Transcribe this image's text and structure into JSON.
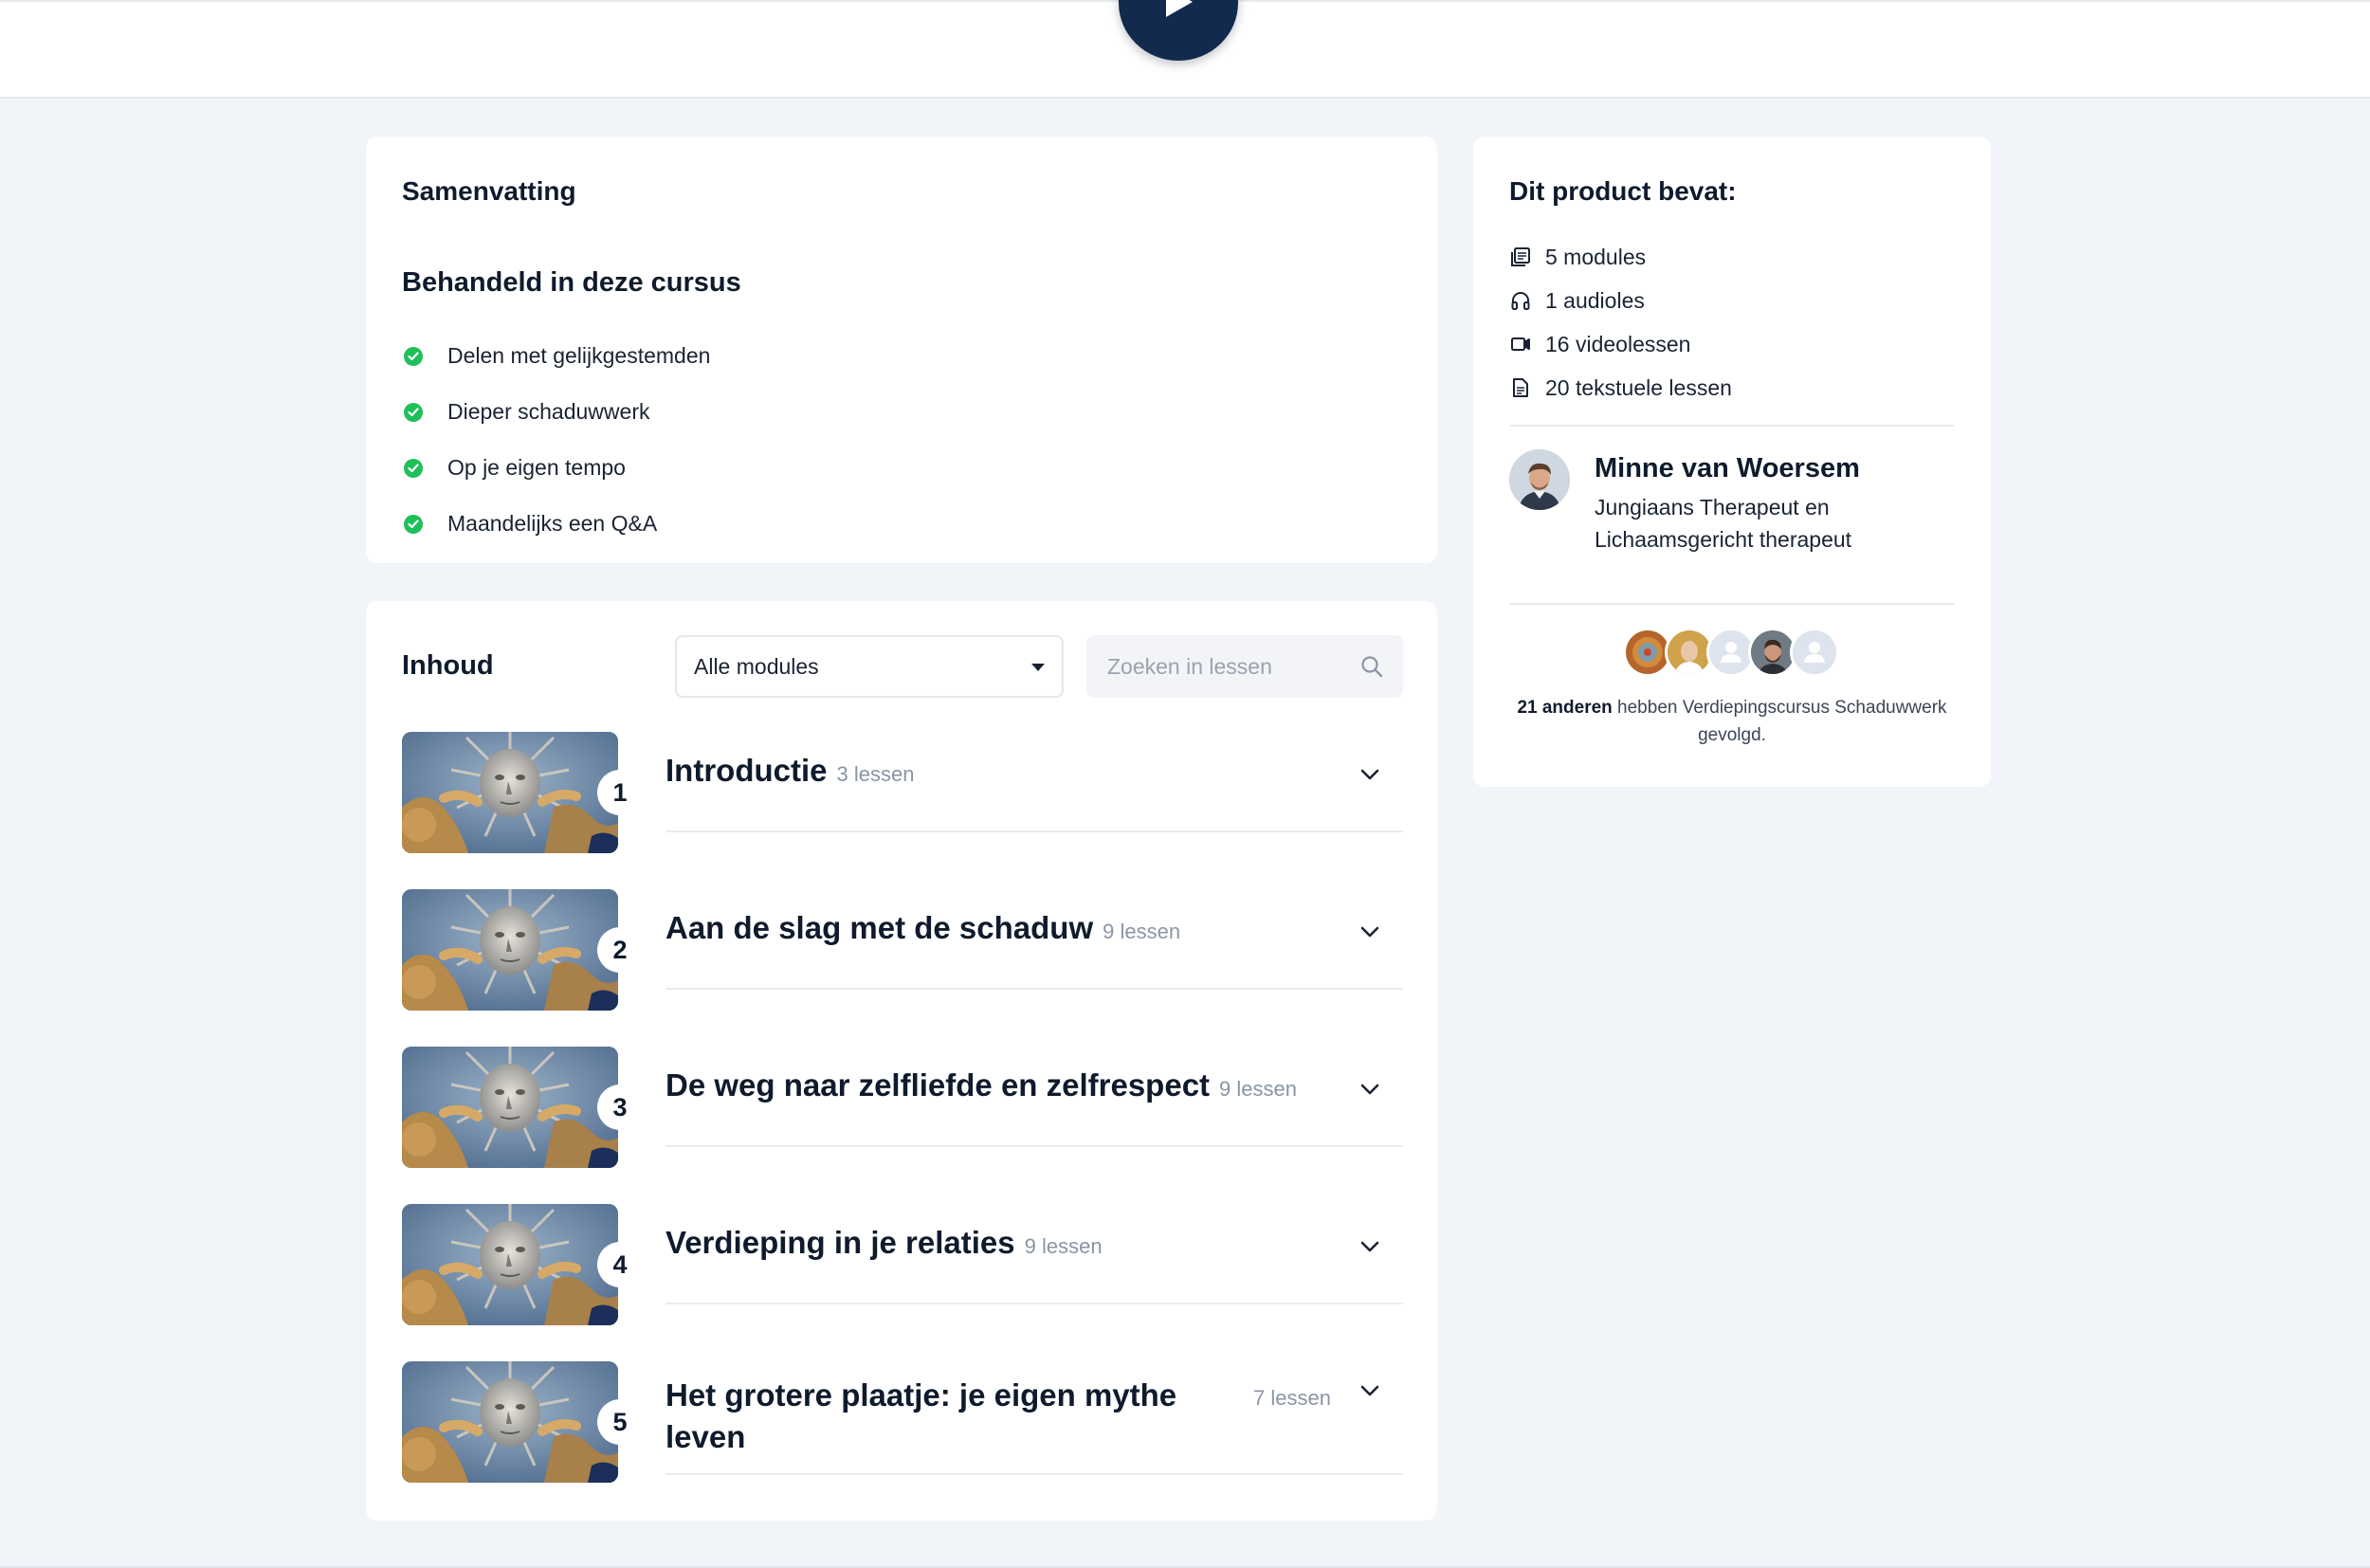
{
  "summary": {
    "title": "Samenvatting",
    "subtitle": "Behandeld in deze cursus",
    "items": [
      "Delen met gelijkgestemden",
      "Dieper schaduwwerk",
      "Op je eigen tempo",
      "Maandelijks een Q&A"
    ]
  },
  "contents": {
    "title": "Inhoud",
    "filter_selected": "Alle modules",
    "search_placeholder": "Zoeken in lessen",
    "modules": [
      {
        "number": "1",
        "title": "Introductie",
        "count": "3 lessen"
      },
      {
        "number": "2",
        "title": "Aan de slag met de schaduw",
        "count": "9 lessen"
      },
      {
        "number": "3",
        "title": "De weg naar zelfliefde en zelfrespect",
        "count": "9 lessen"
      },
      {
        "number": "4",
        "title": "Verdieping in je relaties",
        "count": "9 lessen"
      },
      {
        "number": "5",
        "title": "Het grotere plaatje: je eigen mythe leven",
        "count": "7 lessen"
      }
    ]
  },
  "product": {
    "title": "Dit product bevat:",
    "features": [
      {
        "icon": "modules-icon",
        "label": "5 modules"
      },
      {
        "icon": "headphones-icon",
        "label": "1 audioles"
      },
      {
        "icon": "video-icon",
        "label": "16 videolessen"
      },
      {
        "icon": "document-icon",
        "label": "20 tekstuele lessen"
      }
    ],
    "author": {
      "name": "Minne van Woersem",
      "role": "Jungiaans Therapeut en Lichaamsgericht therapeut"
    },
    "social": {
      "count": "21 anderen",
      "text": "hebben Verdiepingscursus Schaduwwerk gevolgd."
    }
  },
  "colors": {
    "accent_dark": "#112a4d",
    "check_green": "#1fbf5a",
    "page_bg": "#f1f4f8"
  }
}
